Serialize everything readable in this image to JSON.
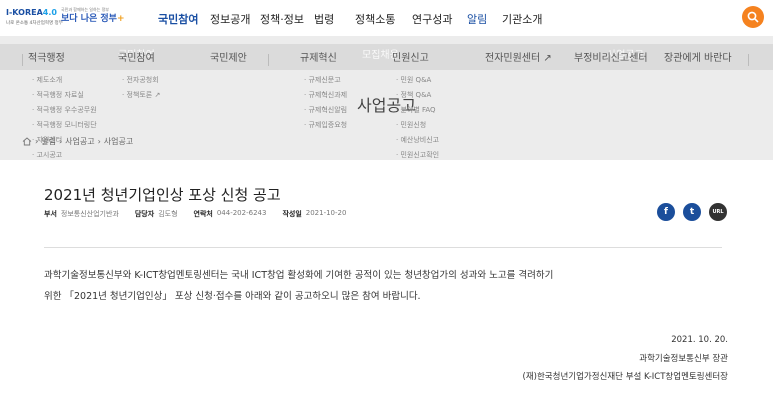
{
  "header": {
    "logo_korea_brand": "I-KOREA",
    "logo_korea_num": "4.0",
    "logo_korea_sub": "나로 온소통 4차산업혁명 정부",
    "logo_gov_sub": "국민과 함께하는 일하는 정부",
    "logo_gov_text": "보다 나은 정부",
    "gnb": [
      "국민참여",
      "정보공개",
      "정책·정보",
      "법령",
      "정책소통",
      "연구성과",
      "알림",
      "기관소개"
    ],
    "search_icon": "search-icon",
    "accent": "#f5821f"
  },
  "hero": {
    "title": "사업공고",
    "ghost_labels": [
      "국민참여",
      "모집채용",
      "사업공고"
    ],
    "mega_heads": [
      "적극행정",
      "국민참여",
      "국민제안",
      "규제혁신",
      "민원신고",
      "전자민원센터",
      "부정비리신고센터",
      "장관에게 바란다"
    ],
    "col1": [
      "제도소개",
      "적극행정 자료실",
      "적극행정 우수공무원",
      "적극행정 모니터링단",
      "지원센터",
      "고시공고"
    ],
    "col2": [
      "전자공청회",
      "정책토론"
    ],
    "col4": [
      "규제신문고",
      "규제혁신과제",
      "규제혁신알림",
      "규제입증요청"
    ],
    "col5": [
      "민원 Q&A",
      "정책 Q&A",
      "분야별 FAQ",
      "민원신청",
      "예산낭비신고",
      "민원신고확인"
    ],
    "breadcrumb": [
      "알림",
      "사업공고",
      "사업공고"
    ]
  },
  "article": {
    "title": "2021년 청년기업인상 포상 신청 공고",
    "meta": [
      {
        "k": "부서",
        "v": "정보통신산업기반과"
      },
      {
        "k": "담당자",
        "v": "김도형"
      },
      {
        "k": "연락처",
        "v": "044-202-6243"
      },
      {
        "k": "작성일",
        "v": "2021-10-20"
      }
    ],
    "share": {
      "fb": "f",
      "tw": "t",
      "url": "URL"
    },
    "body_line1": "과학기술정보통신부와 K-ICT창업멘토링센터는 국내 ICT창업 활성화에 기여한 공적이 있는 청년창업가의 성과와 노고를 격려하기",
    "body_line2": "위한 「2021년 청년기업인상」 포상 신청·접수를 아래와 같이 공고하오니 많은 참여 바랍니다.",
    "date": "2021. 10. 20.",
    "sign1": "과학기술정보통신부 장관",
    "sign2": "(재)한국청년기업가정신재단 부설 K-ICT창업멘토링센터장"
  }
}
